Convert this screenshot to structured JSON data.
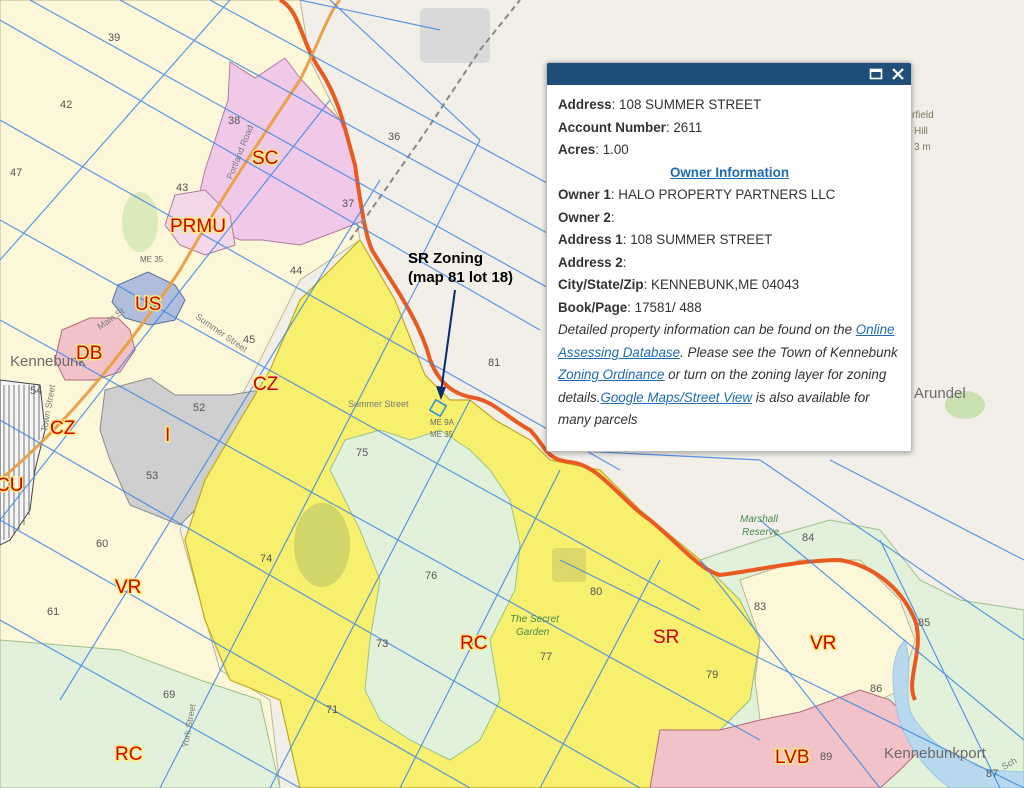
{
  "popup": {
    "fields": [
      {
        "label": "Address",
        "value": "108 SUMMER STREET"
      },
      {
        "label": "Account Number",
        "value": "2611"
      },
      {
        "label": "Acres",
        "value": "1.00"
      }
    ],
    "owner_heading": "Owner Information",
    "owner_fields": [
      {
        "label": "Owner 1",
        "value": "HALO PROPERTY PARTNERS LLC"
      },
      {
        "label": "Owner 2",
        "value": ""
      },
      {
        "label": "Address 1",
        "value": "108 SUMMER STREET"
      },
      {
        "label": "Address 2",
        "value": ""
      },
      {
        "label": "City/State/Zip",
        "value": "KENNEBUNK,ME 04043"
      },
      {
        "label": "Book/Page",
        "value": "17581/ 488"
      }
    ],
    "desc_1": "Detailed property information can be found on the ",
    "link_assessing": "Online Assessing Database",
    "desc_2": ". Please see the Town of Kennebunk ",
    "link_zoning": "Zoning Ordinance",
    "desc_3": " or turn on the zoning layer for zoning details.",
    "link_google": "Google Maps/Street View",
    "desc_4": " is also available for many parcels"
  },
  "annotation": {
    "line1": "SR Zoning",
    "line2": "(map 81 lot 18)"
  },
  "zones": {
    "sc": "SC",
    "prmu": "PRMU",
    "us": "US",
    "db": "DB",
    "cz_1": "CZ",
    "cz_2": "CZ",
    "i": "I",
    "cu": "CU",
    "vr_1": "VR",
    "vr_2": "VR",
    "rc_1": "RC",
    "rc_2": "RC",
    "sr": "SR",
    "lvb": "LVB"
  },
  "grid_numbers": [
    "39",
    "42",
    "47",
    "38",
    "43",
    "44",
    "36",
    "37",
    "45",
    "52",
    "53",
    "54",
    "60",
    "61",
    "69",
    "71",
    "73",
    "74",
    "75",
    "76",
    "77",
    "79",
    "80",
    "81",
    "83",
    "84",
    "85",
    "86",
    "87",
    "89"
  ],
  "roads": {
    "summer_street_1": "Summer Street",
    "summer_street_2": "Summer Street",
    "portland_road": "Portland Road",
    "main_street": "Main St",
    "town_street": "Town Street",
    "york_street": "York Street",
    "school": "Sch"
  },
  "highway_labels": {
    "me35_1": "ME 35",
    "me9a": "ME 9A",
    "me35_2": "ME 35"
  },
  "places": {
    "kennebunk": "Kennebunk",
    "arundel": "Arundel",
    "kennebunkport": "Kennebunkport",
    "secret_garden_1": "The Secret",
    "secret_garden_2": "Garden",
    "marshall_1": "Marshall",
    "marshall_2": "Reserve",
    "hill_1": "rfield",
    "hill_2": "Hill",
    "hill_3": "3 m"
  },
  "colors": {
    "sr_yellow": "#f7ef6e",
    "rc_green": "#e2f2da",
    "vr_cream": "#fbf7d8",
    "sc_pink": "#f1c9e8",
    "db_pink": "#f1c3c9",
    "i_gray": "#cfcfcf",
    "us_blue": "#b0bedc",
    "grid_blue": "#3f87e4",
    "boundary_orange": "#e85a22",
    "header_navy": "#1f4e79",
    "link_blue": "#1f6ab0"
  }
}
